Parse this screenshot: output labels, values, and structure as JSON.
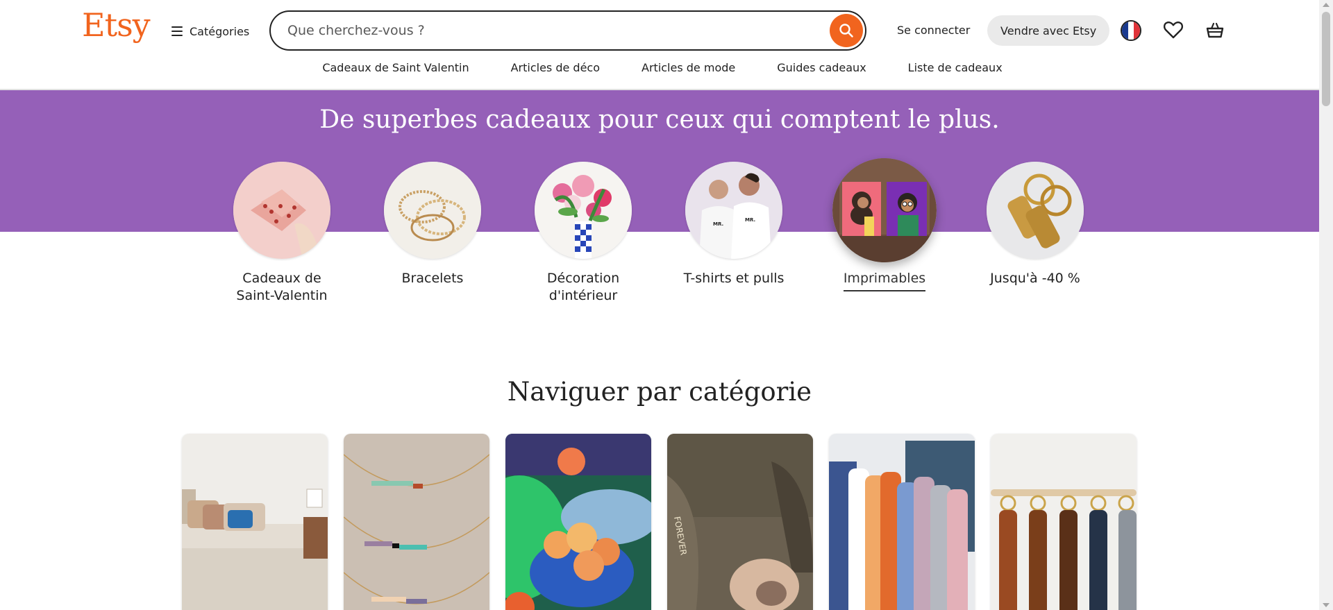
{
  "brand": {
    "logo": "Etsy",
    "accent": "#F1641E"
  },
  "header": {
    "categories_label": "Catégories",
    "search_placeholder": "Que cherchez-vous ?",
    "signin_label": "Se connecter",
    "sell_label": "Vendre avec Etsy",
    "language_flag": "france-flag-icon"
  },
  "subnav": [
    "Cadeaux de Saint Valentin",
    "Articles de déco",
    "Articles de mode",
    "Guides cadeaux",
    "Liste de cadeaux"
  ],
  "hero": {
    "title": "De superbes cadeaux pour ceux qui comptent le plus.",
    "background": "#9560B8",
    "circles": [
      {
        "label": "Cadeaux de Saint-Valentin"
      },
      {
        "label": "Bracelets"
      },
      {
        "label": "Décoration d'intérieur"
      },
      {
        "label": "T-shirts et pulls"
      },
      {
        "label": "Imprimables",
        "selected": true
      },
      {
        "label": "Jusqu'à -40 %"
      }
    ]
  },
  "browse": {
    "title": "Naviguer par catégorie"
  }
}
